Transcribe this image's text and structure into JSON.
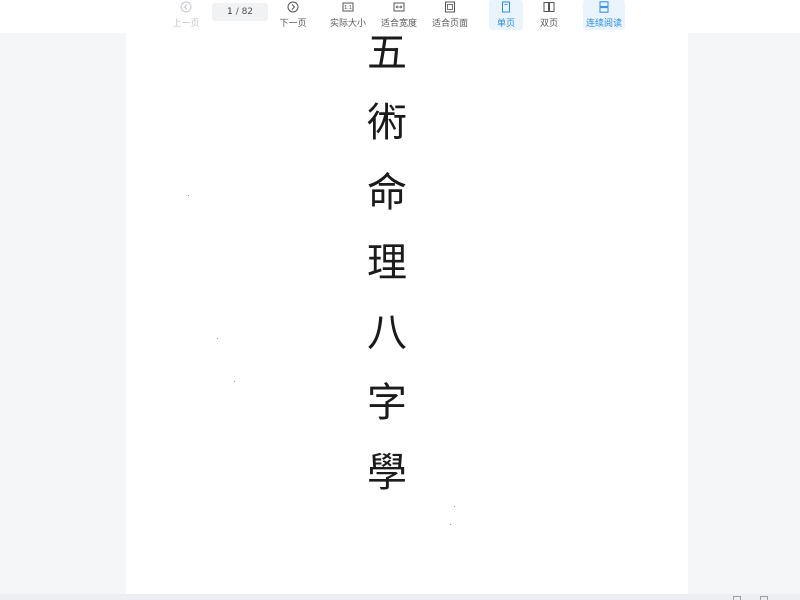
{
  "toolbar": {
    "prev_label": "上一页",
    "page_current": "1",
    "page_total": "/ 82",
    "next_label": "下一页",
    "actual_size_label": "实际大小",
    "fit_width_label": "适合宽度",
    "fit_page_label": "适合页面",
    "single_page_label": "单页",
    "double_page_label": "双页",
    "continuous_label": "连续阅读"
  },
  "document": {
    "title_chars": [
      "五",
      "術",
      "命",
      "理",
      "八",
      "字",
      "學"
    ]
  },
  "colors": {
    "accent": "#2e8ae6",
    "active_bg": "#e9f4fd",
    "background": "#f5f6f8"
  },
  "icons": {
    "prev": "chevron-left-circle-icon",
    "next": "chevron-right-circle-icon",
    "actual_size": "actual-size-icon",
    "fit_width": "fit-width-icon",
    "fit_page": "fit-page-icon",
    "single_page": "single-page-icon",
    "double_page": "double-page-icon",
    "continuous": "continuous-scroll-icon"
  }
}
